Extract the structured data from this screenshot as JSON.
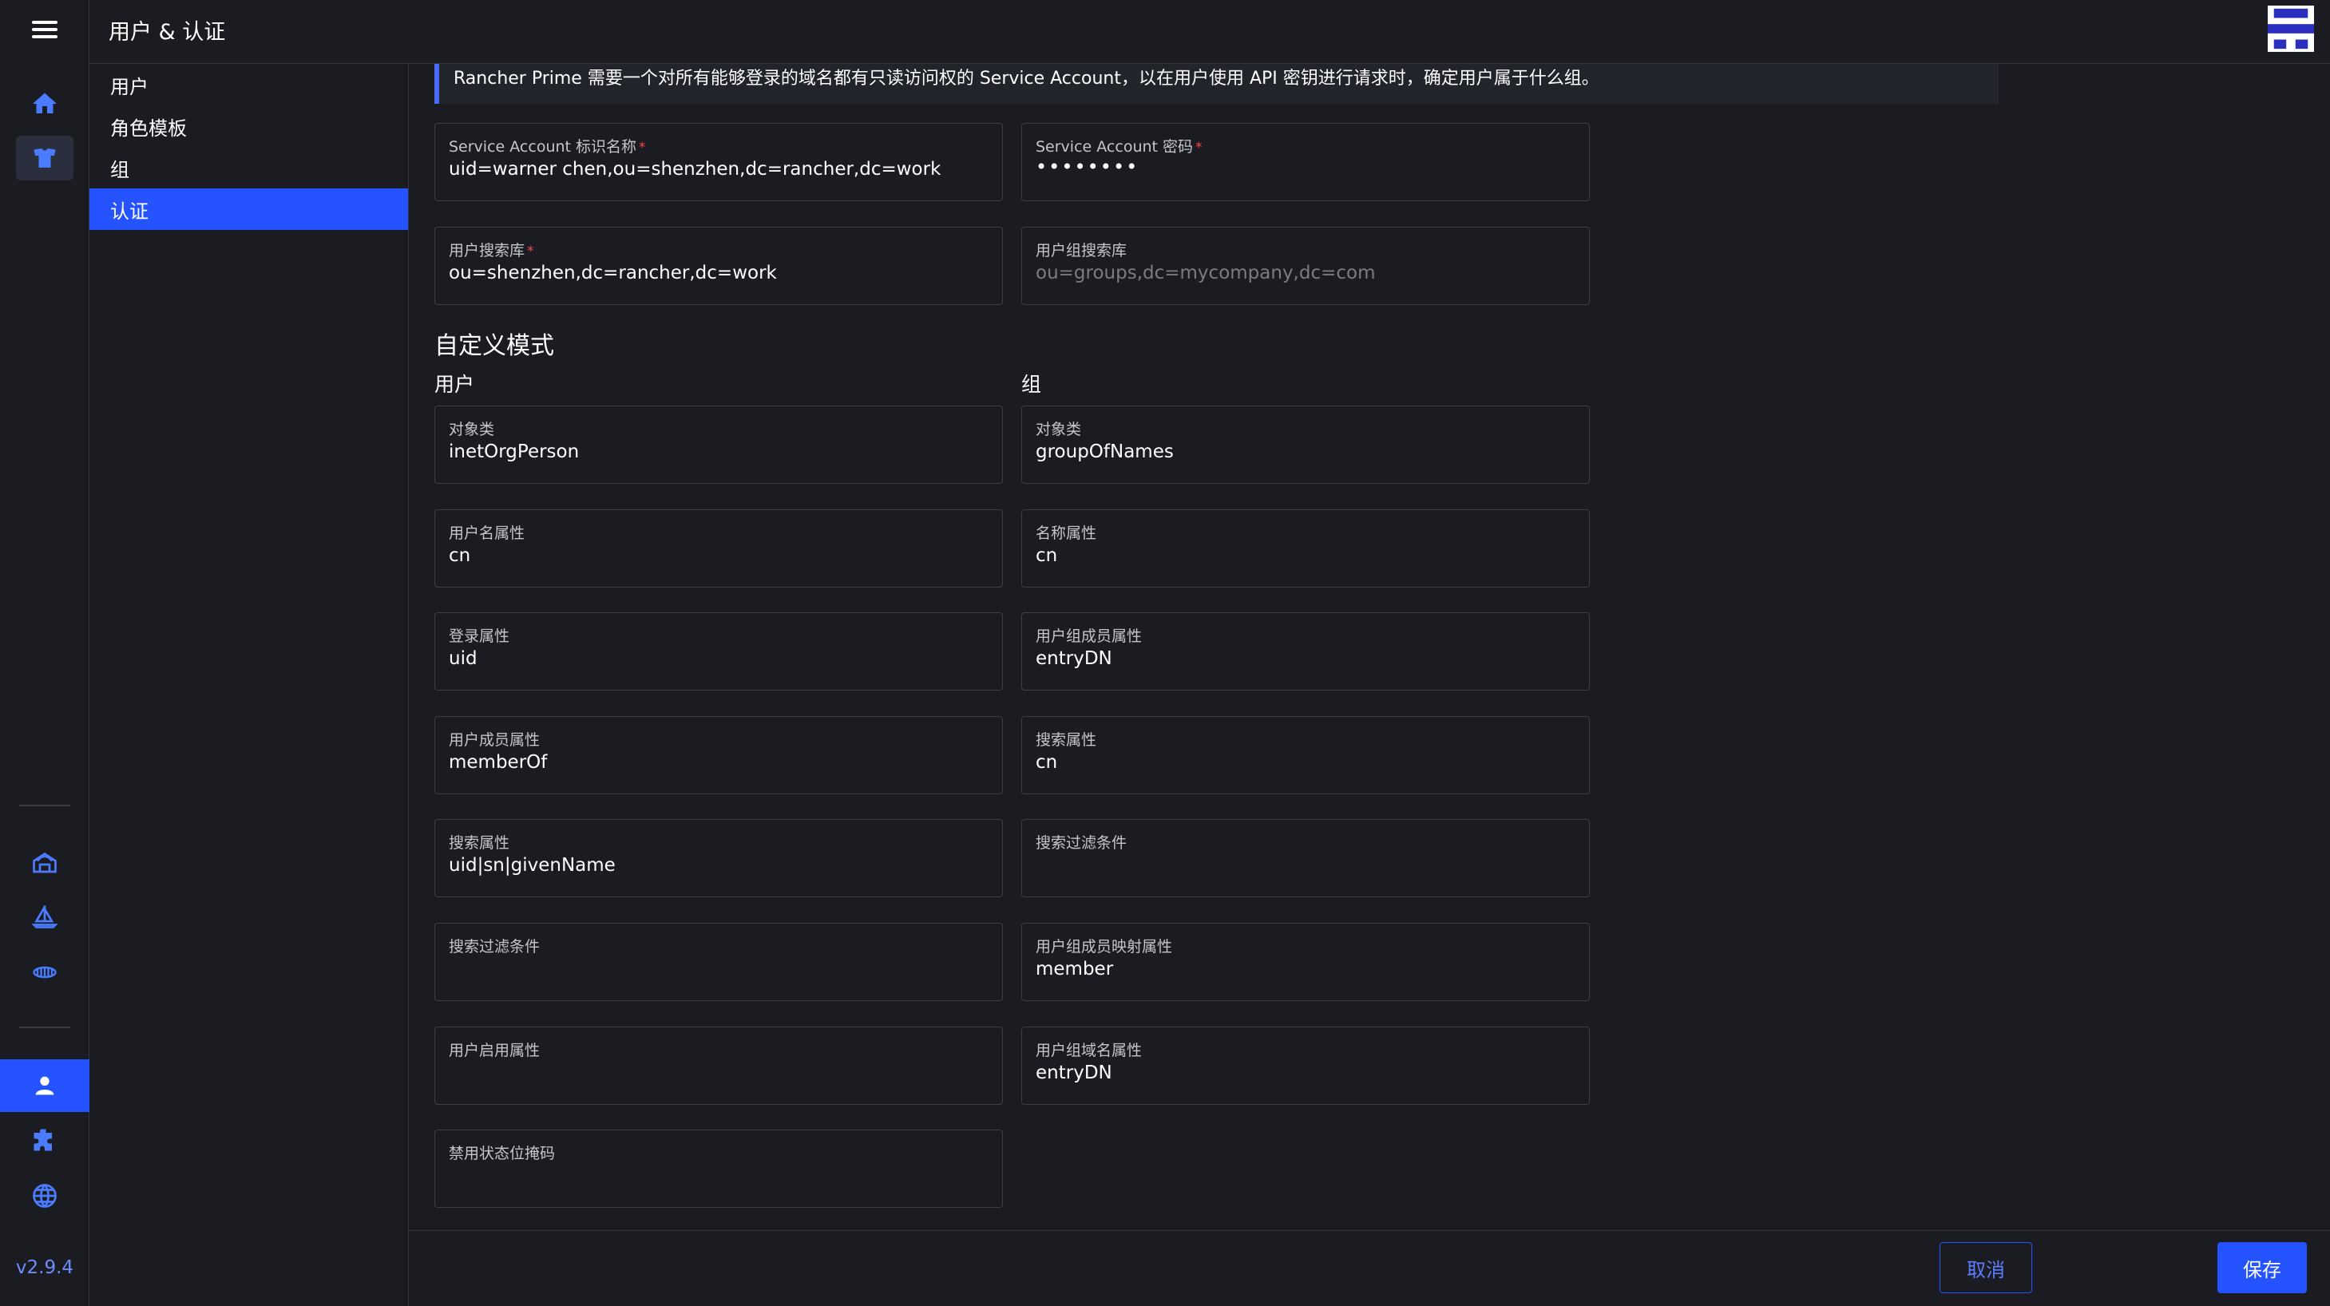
{
  "app": {
    "title": "用户 & 认证",
    "version": "v2.9.4"
  },
  "rail": {
    "icons": [
      "menu-icon",
      "home-icon",
      "cluster-icon",
      "fleet-icon",
      "continuous-delivery-icon",
      "multicluster-apps-icon",
      "users-icon",
      "extensions-icon",
      "globe-icon"
    ]
  },
  "subnav": {
    "items": [
      {
        "label": "用户",
        "active": false
      },
      {
        "label": "角色模板",
        "active": false
      },
      {
        "label": "组",
        "active": false
      },
      {
        "label": "认证",
        "active": true
      }
    ]
  },
  "banner": {
    "text": "Rancher Prime 需要一个对所有能够登录的域名都有只读访问权的 Service Account，以在用户使用 API 密钥进行请求时，确定用户属于什么组。"
  },
  "service": {
    "sa_name": {
      "label": "Service Account 标识名称",
      "required": "*",
      "value": "uid=warner chen,ou=shenzhen,dc=rancher,dc=work"
    },
    "sa_password": {
      "label": "Service Account 密码",
      "required": "*",
      "value": "••••••••"
    },
    "user_base": {
      "label": "用户搜索库",
      "required": "*",
      "value": "ou=shenzhen,dc=rancher,dc=work"
    },
    "group_base": {
      "label": "用户组搜索库",
      "placeholder": "ou=groups,dc=mycompany,dc=com"
    }
  },
  "schema": {
    "title": "自定义模式",
    "user_title": "用户",
    "group_title": "组",
    "user_fields": [
      {
        "label": "对象类",
        "value": "inetOrgPerson"
      },
      {
        "label": "用户名属性",
        "value": "cn"
      },
      {
        "label": "登录属性",
        "value": "uid"
      },
      {
        "label": "用户成员属性",
        "value": "memberOf"
      },
      {
        "label": "搜索属性",
        "value": "uid|sn|givenName"
      },
      {
        "label": "搜索过滤条件",
        "value": ""
      },
      {
        "label": "用户启用属性",
        "value": ""
      },
      {
        "label": "禁用状态位掩码",
        "value": ""
      }
    ],
    "group_fields": [
      {
        "label": "对象类",
        "value": "groupOfNames"
      },
      {
        "label": "名称属性",
        "value": "cn"
      },
      {
        "label": "用户组成员属性",
        "value": "entryDN"
      },
      {
        "label": "搜索属性",
        "value": "cn"
      },
      {
        "label": "搜索过滤条件",
        "value": ""
      },
      {
        "label": "用户组成员映射属性",
        "value": "member"
      },
      {
        "label": "用户组域名属性",
        "value": "entryDN"
      }
    ]
  },
  "footer": {
    "cancel_label": "取消",
    "save_label": "保存"
  },
  "colors": {
    "accent": "#2453ff",
    "background": "#1b1c21",
    "required": "#f64747"
  }
}
